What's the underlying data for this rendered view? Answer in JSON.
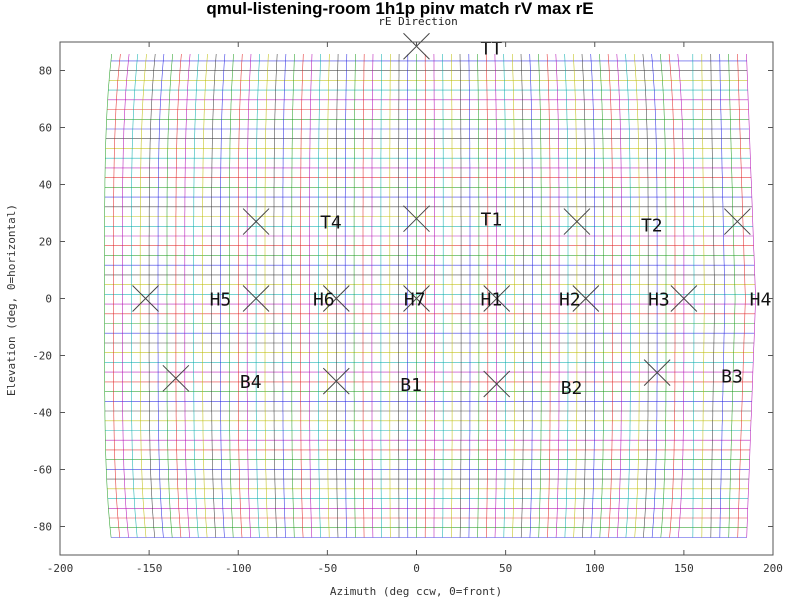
{
  "chart_data": {
    "type": "scatter",
    "title": "qmul-listening-room 1h1p pinv match rV max rE",
    "subtitle": "rE Direction",
    "xlabel": "Azimuth (deg ccw, 0=front)",
    "ylabel": "Elevation (deg, 0=horizontal)",
    "xlim": [
      -200,
      200
    ],
    "ylim": [
      -90,
      90
    ],
    "xticks": [
      -200,
      -150,
      -100,
      -50,
      0,
      50,
      100,
      150,
      200
    ],
    "yticks": [
      -80,
      -60,
      -40,
      -20,
      0,
      20,
      40,
      60,
      80
    ],
    "grid": false,
    "legend": "none",
    "speakers": [
      {
        "label": "TT",
        "az": 0,
        "el": 90
      },
      {
        "label": "T1",
        "az": 0,
        "el": 28
      },
      {
        "label": "T2",
        "az": 90,
        "el": 27
      },
      {
        "label": "T4",
        "az": -90,
        "el": 27
      },
      {
        "label": "H1",
        "az": -45,
        "el": 0
      },
      {
        "label": "H2",
        "az": 0,
        "el": 0
      },
      {
        "label": "H3",
        "az": 45,
        "el": 0
      },
      {
        "label": "H4",
        "az": 150,
        "el": 0
      },
      {
        "label": "H5",
        "az": -152,
        "el": 0
      },
      {
        "label": "H6",
        "az": -90,
        "el": 0
      },
      {
        "label": "H7",
        "az": 95,
        "el": 0
      },
      {
        "label": "B1",
        "az": -45,
        "el": -29
      },
      {
        "label": "B2",
        "az": 45,
        "el": -30
      },
      {
        "label": "B3",
        "az": 135,
        "el": -26
      },
      {
        "label": "B4",
        "az": -135,
        "el": -28
      },
      {
        "label": "",
        "az": 180,
        "el": 27
      }
    ],
    "label_positions": {
      "TT": [
        42,
        88
      ],
      "T1": [
        42,
        28
      ],
      "T2": [
        132,
        26
      ],
      "T4": [
        -48,
        27
      ],
      "H1": [
        42,
        0
      ],
      "H2": [
        86,
        0
      ],
      "H3": [
        136,
        0
      ],
      "H4": [
        193,
        0
      ],
      "H5": [
        -110,
        0
      ],
      "H6": [
        -52,
        0
      ],
      "H7": [
        -1,
        0
      ],
      "B1": [
        -3,
        -30
      ],
      "B2": [
        87,
        -31
      ],
      "B3": [
        177,
        -27
      ],
      "B4": [
        -93,
        -29
      ]
    },
    "grid_colors": [
      "#1f1fe0",
      "#1a9a1a",
      "#e01f1f",
      "#b000b0",
      "#00aaaa",
      "#bbbb00",
      "#333333"
    ]
  }
}
